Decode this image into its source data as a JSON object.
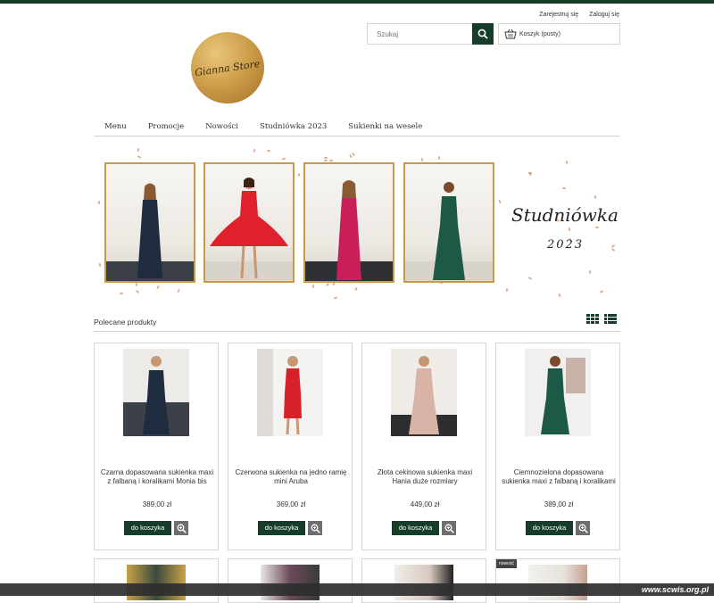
{
  "header": {
    "register": "Zarejestruj się",
    "login": "Zaloguj się",
    "search_placeholder": "Szukaj",
    "cart_label": "Koszyk",
    "cart_status": "(pusty)",
    "logo_text": "Gianna Store"
  },
  "nav": {
    "items": [
      "Menu",
      "Promocje",
      "Nowości",
      "Studniówka 2023",
      "Sukienki na wesele"
    ]
  },
  "banner": {
    "title": "Studniówka",
    "year": "2023"
  },
  "section": {
    "title": "Polecane produkty"
  },
  "products": [
    {
      "name": "Czarna dopasowana sukienka maxi z falbaną i koralikami Monia bis",
      "price": "389,00 zł",
      "add": "do koszyka",
      "dress_color": "#1f2b3f"
    },
    {
      "name": "Czerwona sukienka na jedno ramię mini Aruba",
      "price": "369,00 zł",
      "add": "do koszyka",
      "dress_color": "#d8202b"
    },
    {
      "name": "Złota cekinowa sukienka maxi Hania duże rozmiary",
      "price": "449,00 zł",
      "add": "do koszyka",
      "dress_color": "#d9b3a5"
    },
    {
      "name": "Ciemnozielona dopasowana sukienka maxi z falbaną i koralikami",
      "price": "389,00 zł",
      "add": "do koszyka",
      "dress_color": "#1d5a45"
    }
  ],
  "second_row": {
    "badge": "nowość"
  },
  "watermark": "www.scwis.org.pl",
  "colors": {
    "brand_green": "#163d2a",
    "gold": "#c89a45"
  }
}
